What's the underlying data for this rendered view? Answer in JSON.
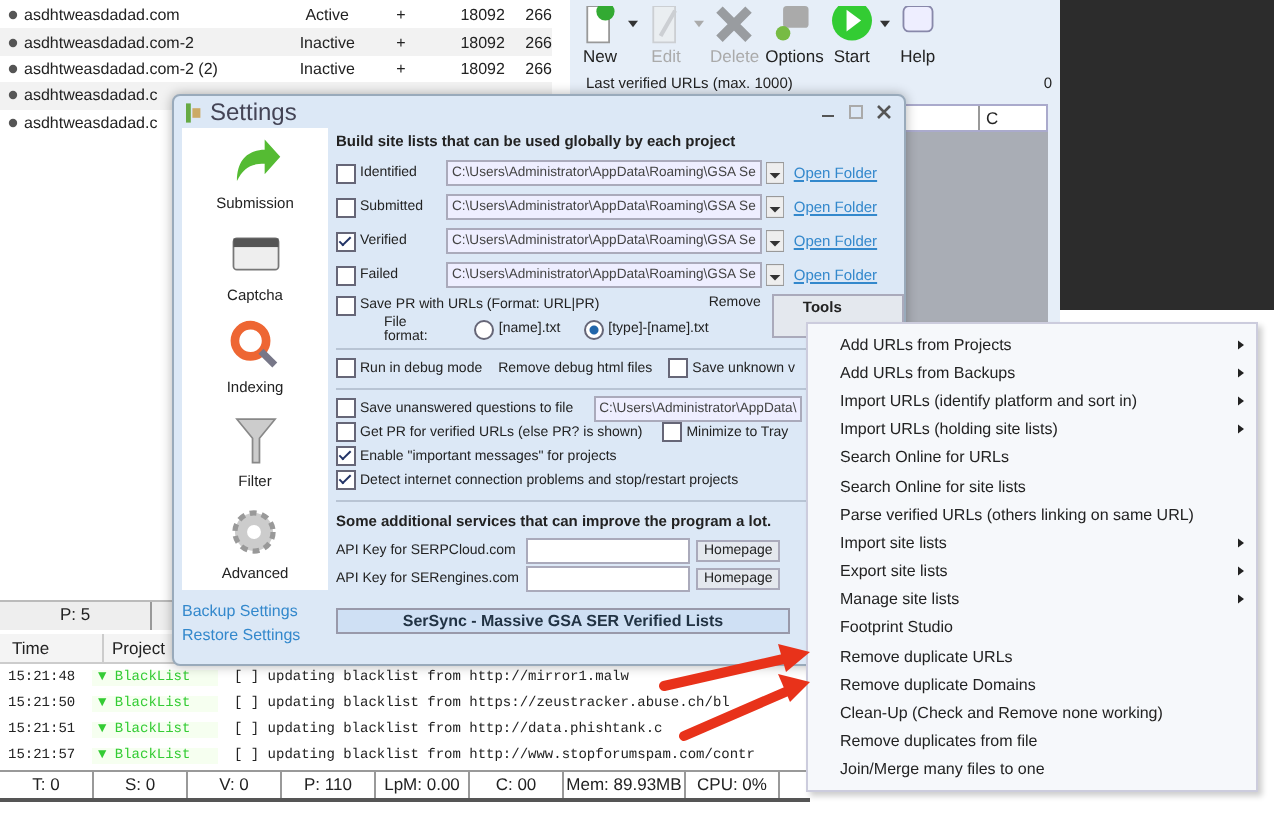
{
  "projects": {
    "rows": [
      {
        "name": "asdhtweasdadad.com",
        "status": "Active",
        "flag": "+",
        "col_4": "18092",
        "col_5": "266"
      },
      {
        "name": "asdhtweasdadad.com-2",
        "status": "Inactive",
        "flag": "+",
        "col_4": "18092",
        "col_5": "266"
      },
      {
        "name": "asdhtweasdadad.com-2 (2)",
        "status": "Inactive",
        "flag": "+",
        "col_4": "18092",
        "col_5": "266"
      },
      {
        "name": "asdhtweasdadad.c"
      },
      {
        "name": "asdhtweasdadad.c"
      }
    ]
  },
  "toolbar": {
    "buttons": [
      {
        "kind": "new",
        "label": "New",
        "disabled": false,
        "dropdown": true
      },
      {
        "kind": "edit",
        "label": "Edit",
        "disabled": true,
        "dropdown": true
      },
      {
        "kind": "delete",
        "label": "Delete",
        "disabled": true,
        "dropdown": false
      },
      {
        "kind": "options",
        "label": "Options",
        "disabled": false,
        "dropdown": false
      },
      {
        "kind": "start",
        "label": "Start",
        "disabled": false,
        "dropdown": true
      },
      {
        "kind": "help",
        "label": "Help",
        "disabled": false,
        "dropdown": false
      }
    ]
  },
  "verified_panel": {
    "title": "Last verified URLs (max. 1000)",
    "count": "0",
    "column": "C"
  },
  "upper_status": "P: 5",
  "log": {
    "columns": [
      "Time",
      "Project"
    ],
    "rows": [
      {
        "time": "15:21:48",
        "project": "▼ BlackList",
        "message": "[ ] updating blacklist from http://mirror1.malw"
      },
      {
        "time": "15:21:50",
        "project": "▼ BlackList",
        "message": "[ ] updating blacklist from https://zeustracker.abuse.ch/bl"
      },
      {
        "time": "15:21:51",
        "project": "▼ BlackList",
        "message": "[ ] updating blacklist from http://data.phishtank.c"
      },
      {
        "time": "15:21:57",
        "project": "▼ BlackList",
        "message": "[ ] updating blacklist from http://www.stopforumspam.com/contr"
      }
    ]
  },
  "status_bar": [
    "T: 0",
    "S: 0",
    "V: 0",
    "P: 110",
    "LpM: 0.00",
    "C: 00",
    "Mem: 89.93MB",
    "CPU: 0%"
  ],
  "settings": {
    "title": "Settings",
    "sidebar": [
      {
        "kind": "submission",
        "label": "Submission"
      },
      {
        "kind": "captcha",
        "label": "Captcha"
      },
      {
        "kind": "indexing",
        "label": "Indexing"
      },
      {
        "kind": "filter",
        "label": "Filter"
      },
      {
        "kind": "advanced",
        "label": "Advanced"
      }
    ],
    "links": [
      "Backup Settings",
      "Restore Settings"
    ],
    "site_lists": {
      "heading": "Build site lists that can be used globally by each project",
      "rows": [
        {
          "label": "Identified",
          "checked": false,
          "path": "C:\\Users\\Administrator\\AppData\\Roaming\\GSA Se",
          "link": "Open Folder"
        },
        {
          "label": "Submitted",
          "checked": false,
          "path": "C:\\Users\\Administrator\\AppData\\Roaming\\GSA Se",
          "link": "Open Folder"
        },
        {
          "label": "Verified",
          "checked": true,
          "path": "C:\\Users\\Administrator\\AppData\\Roaming\\GSA Se",
          "link": "Open Folder"
        },
        {
          "label": "Failed",
          "checked": false,
          "path": "C:\\Users\\Administrator\\AppData\\Roaming\\GSA Se",
          "link": "Open Folder"
        }
      ]
    },
    "save_pr": {
      "label": "Save PR with URLs (Format: URL|PR)",
      "checked": false
    },
    "remove_label": "Remove",
    "tools_button": "Tools",
    "file_format": {
      "label": "File format:",
      "options": [
        {
          "label": "[name].txt",
          "selected": false
        },
        {
          "label": "[type]-[name].txt",
          "selected": true
        }
      ]
    },
    "debug_row": {
      "debug": {
        "label": "Run in debug mode",
        "checked": false
      },
      "remove_debug": "Remove debug html files",
      "save_unknown": {
        "label": "Save unknown v",
        "checked": false
      }
    },
    "options": [
      {
        "kind": "file",
        "label": "Save unanswered questions to file",
        "checked": false,
        "path": "C:\\Users\\Administrator\\AppData\\"
      },
      {
        "kind": "pair",
        "label": "Get PR for verified URLs (else PR? is shown)",
        "checked": false,
        "extra": {
          "label": "Minimize to Tray",
          "checked": false
        }
      },
      {
        "kind": "plain",
        "label": "Enable \"important messages\" for projects",
        "checked": true
      },
      {
        "kind": "plain",
        "label": "Detect internet connection problems and stop/restart projects",
        "checked": true
      }
    ],
    "services": {
      "heading": "Some additional services that can improve the program a lot.",
      "rows": [
        {
          "label": "API Key for SERPCloud.com",
          "button": "Homepage"
        },
        {
          "label": "API Key for SERengines.com",
          "button": "Homepage"
        }
      ]
    },
    "banner": "SerSync - Massive GSA SER Verified Lists"
  },
  "menu": {
    "items": [
      {
        "label": "Add URLs from Projects",
        "submenu": true
      },
      {
        "label": "Add URLs from Backups",
        "submenu": true
      },
      {
        "label": "Import URLs (identify platform and sort in)",
        "submenu": true
      },
      {
        "label": "Import URLs (holding site lists)",
        "submenu": true
      },
      {
        "label": "Search Online for URLs",
        "submenu": false
      },
      {
        "label": "Search Online for site lists",
        "submenu": false
      },
      {
        "label": "Parse verified URLs (others linking on same URL)",
        "submenu": false
      },
      {
        "label": "Import site lists",
        "submenu": true
      },
      {
        "label": "Export site lists",
        "submenu": true
      },
      {
        "label": "Manage site lists",
        "submenu": true
      },
      {
        "label": "Footprint Studio",
        "submenu": false
      },
      {
        "label": "Remove duplicate URLs",
        "submenu": false
      },
      {
        "label": "Remove duplicate Domains",
        "submenu": false
      },
      {
        "label": "Clean-Up (Check and Remove none working)",
        "submenu": false
      },
      {
        "label": "Remove duplicates from file",
        "submenu": false
      },
      {
        "label": "Join/Merge many files to one",
        "submenu": false
      }
    ]
  }
}
